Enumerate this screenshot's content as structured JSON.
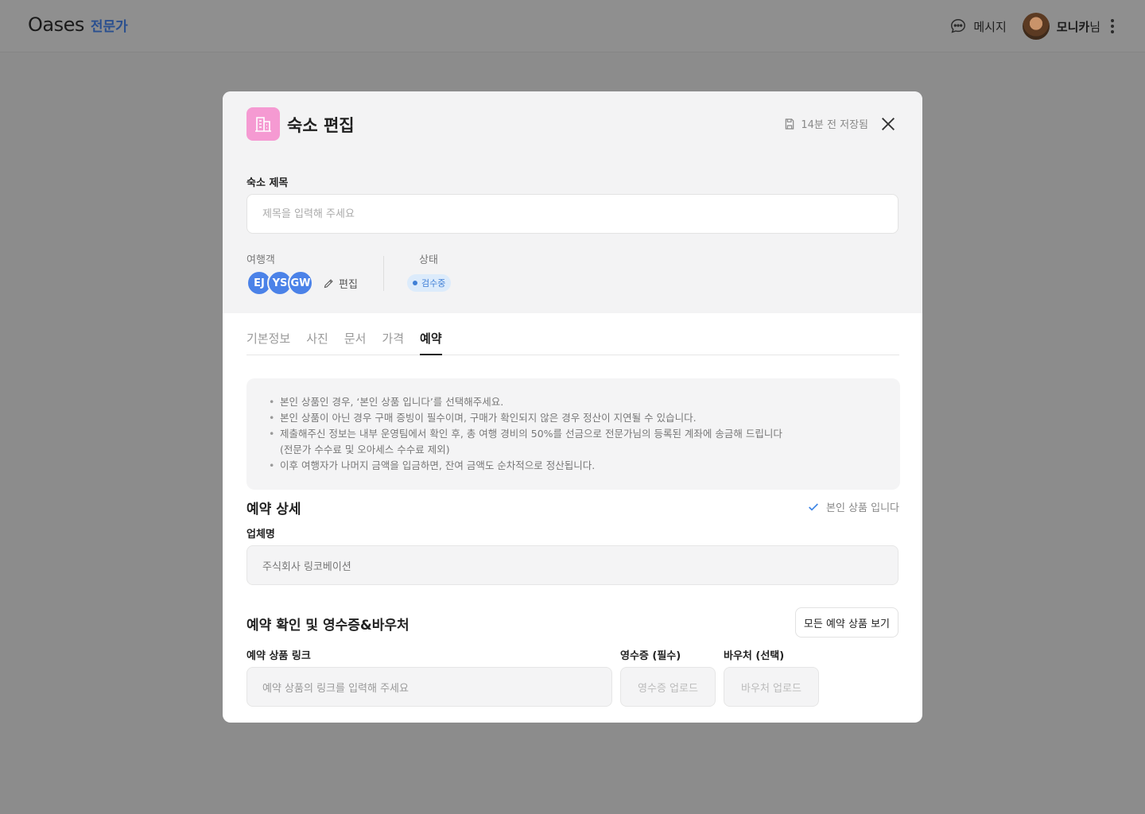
{
  "topbar": {
    "brand_name": "Oases",
    "brand_tag": "전문가",
    "message_label": "메시지",
    "user_name": "모니카",
    "user_suffix": "님"
  },
  "modal": {
    "title": "숙소 편집",
    "saved_text": "14분 전 저장됨",
    "title_label": "숙소 제목",
    "title_placeholder": "제목을 입력해 주세요",
    "travelers_label": "여행객",
    "travelers": [
      "EJ",
      "YS",
      "GW"
    ],
    "edit_label": "편집",
    "status_label": "상태",
    "status_value": "검수중",
    "tabs": [
      {
        "label": "기본정보",
        "active": false
      },
      {
        "label": "사진",
        "active": false
      },
      {
        "label": "문서",
        "active": false
      },
      {
        "label": "가격",
        "active": false
      },
      {
        "label": "예약",
        "active": true
      }
    ],
    "notice": [
      "본인 상품인 경우, ‘본인 상품 입니다’를 선택해주세요.",
      "본인 상품이 아닌 경우 구매 증빙이 필수이며, 구매가 확인되지 않은 경우 정산이 지연될 수 있습니다.",
      "제출해주신 정보는 내부 운영팀에서 확인 후, 총 여행 경비의 50%를 선금으로 전문가님의 등록된 계좌에 송금해 드립니다",
      "(전문가 수수료 및 오아세스 수수료 제외)",
      "이후 여행자가 나머지 금액을 입금하면, 잔여 금액도 순차적으로 정산됩니다."
    ],
    "detail_title": "예약 상세",
    "own_product_label": "본인 상품 입니다",
    "company_label": "업체명",
    "company_value": "주식회사 링코베이션",
    "receipt_section_title": "예약 확인 및 영수증&바우처",
    "view_all_button": "모든 예약 상품 보기",
    "link_label": "예약 상품 링크",
    "link_placeholder": "예약 상품의 링크를 입력해 주세요",
    "receipt_label": "영수증 (필수)",
    "receipt_upload": "영수증 업로드",
    "voucher_label": "바우처 (선택)",
    "voucher_upload": "바우처 업로드"
  },
  "colors": {
    "accent_blue": "#4b82e8",
    "status_blue": "#3f7fd6",
    "head_icon_pink": "#f59ad2",
    "brand_tag": "#2a4f8f"
  }
}
